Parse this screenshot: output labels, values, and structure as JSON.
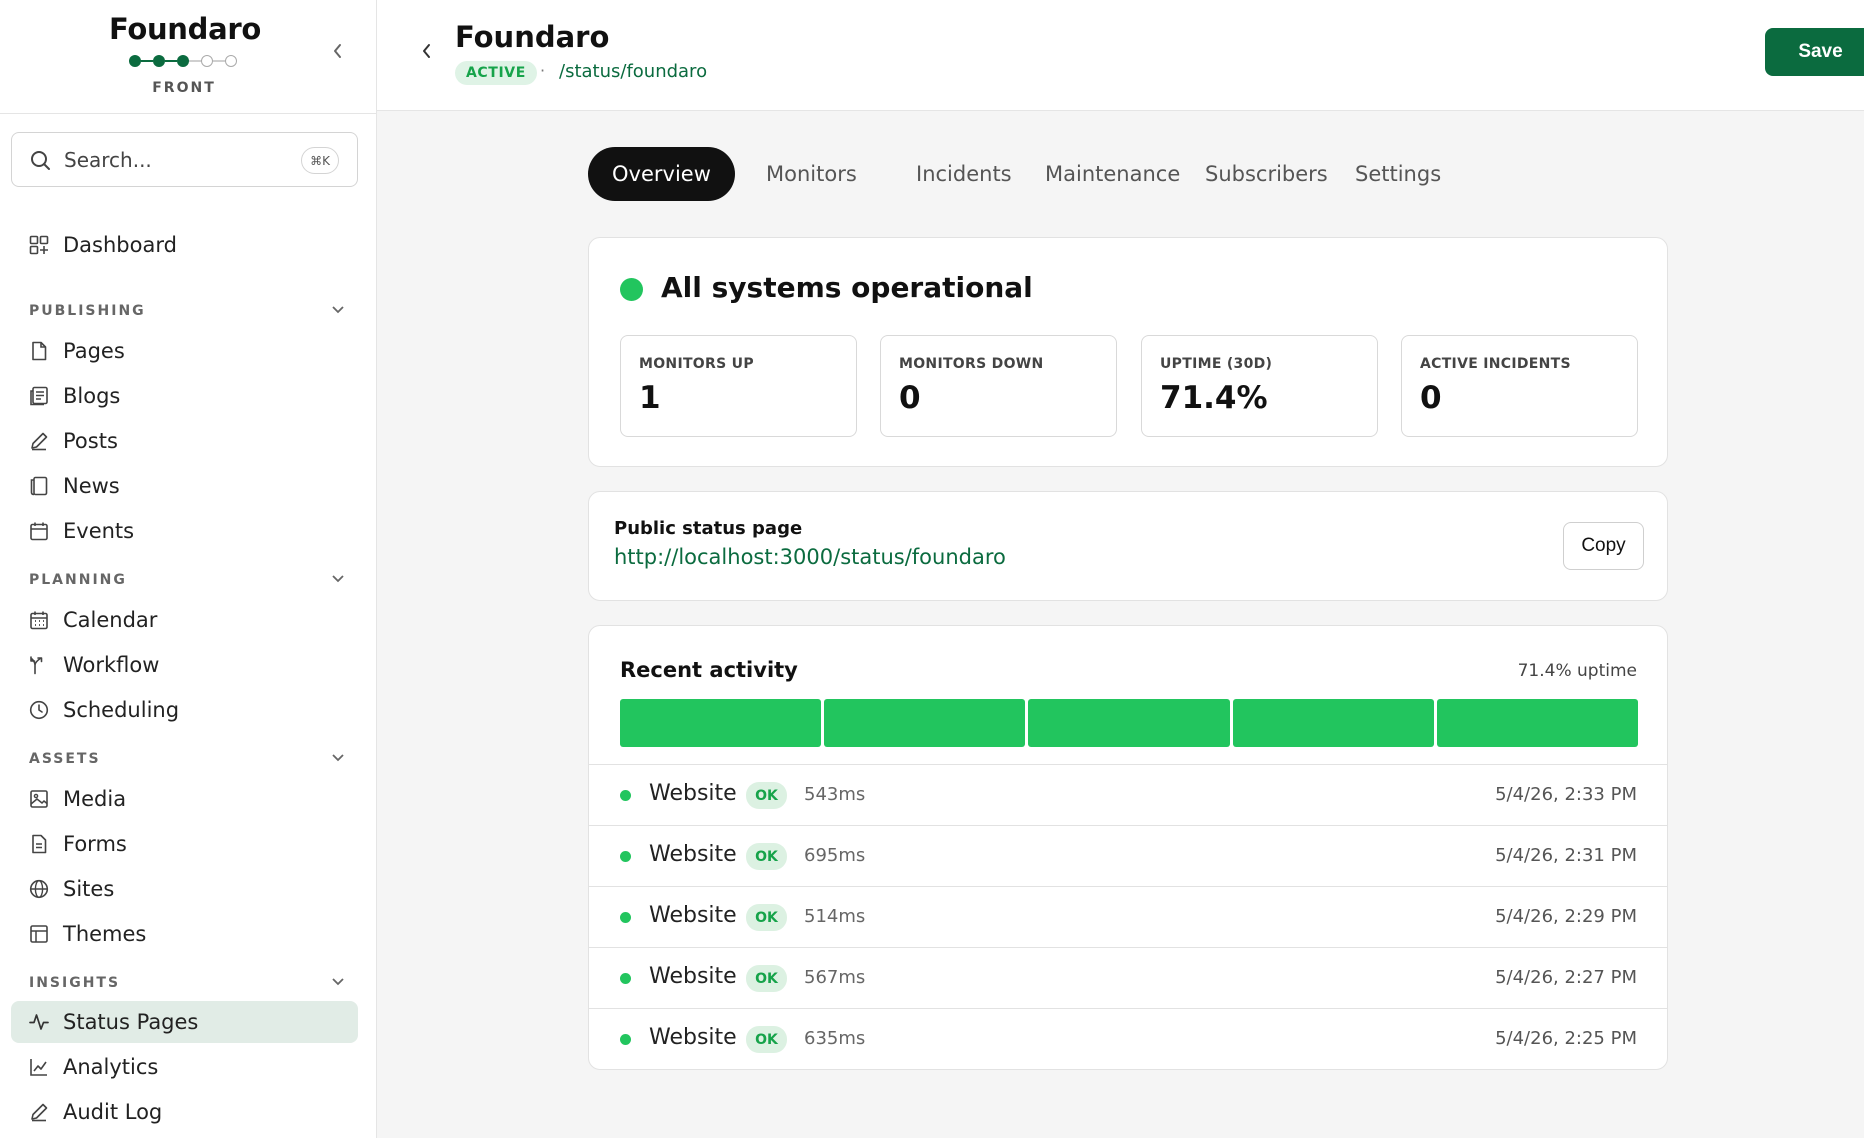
{
  "brand": {
    "name": "Foundaro",
    "sub": "FRONT",
    "steps_done": 3,
    "steps_total": 5
  },
  "search": {
    "placeholder": "Search...",
    "shortcut": "⌘K"
  },
  "sidebar": {
    "dashboard": {
      "label": "Dashboard",
      "icon": "dashboard-icon"
    },
    "sections": [
      {
        "title": "PUBLISHING",
        "items": [
          {
            "label": "Pages",
            "icon": "page-icon"
          },
          {
            "label": "Blogs",
            "icon": "blog-icon"
          },
          {
            "label": "Posts",
            "icon": "pen-icon"
          },
          {
            "label": "News",
            "icon": "news-icon"
          },
          {
            "label": "Events",
            "icon": "calendar-icon"
          }
        ]
      },
      {
        "title": "PLANNING",
        "items": [
          {
            "label": "Calendar",
            "icon": "calendar-grid-icon"
          },
          {
            "label": "Workflow",
            "icon": "workflow-icon"
          },
          {
            "label": "Scheduling",
            "icon": "clock-icon"
          }
        ]
      },
      {
        "title": "ASSETS",
        "items": [
          {
            "label": "Media",
            "icon": "image-icon"
          },
          {
            "label": "Forms",
            "icon": "form-icon"
          },
          {
            "label": "Sites",
            "icon": "globe-icon"
          },
          {
            "label": "Themes",
            "icon": "layout-icon"
          }
        ]
      },
      {
        "title": "INSIGHTS",
        "items": [
          {
            "label": "Status Pages",
            "icon": "activity-icon",
            "active": true
          },
          {
            "label": "Analytics",
            "icon": "chart-icon"
          },
          {
            "label": "Audit Log",
            "icon": "pen-icon"
          }
        ]
      }
    ]
  },
  "header": {
    "title": "Foundaro",
    "status": "ACTIVE",
    "separator": "·",
    "path": "/status/foundaro",
    "save_label": "Save"
  },
  "tabs": [
    "Overview",
    "Monitors",
    "Incidents",
    "Maintenance",
    "Subscribers",
    "Settings"
  ],
  "active_tab": "Overview",
  "overview": {
    "headline": "All systems operational",
    "stats": [
      {
        "label": "MONITORS UP",
        "value": "1"
      },
      {
        "label": "MONITORS DOWN",
        "value": "0"
      },
      {
        "label": "UPTIME (30D)",
        "value": "71.4%"
      },
      {
        "label": "ACTIVE INCIDENTS",
        "value": "0"
      }
    ]
  },
  "public_page": {
    "label": "Public status page",
    "url": "http://localhost:3000/status/foundaro",
    "copy_label": "Copy"
  },
  "activity": {
    "title": "Recent activity",
    "uptime": "71.4% uptime",
    "bar_count": 5,
    "rows": [
      {
        "name": "Website",
        "status": "OK",
        "latency": "543ms",
        "time": "5/4/26, 2:33 PM"
      },
      {
        "name": "Website",
        "status": "OK",
        "latency": "695ms",
        "time": "5/4/26, 2:31 PM"
      },
      {
        "name": "Website",
        "status": "OK",
        "latency": "514ms",
        "time": "5/4/26, 2:29 PM"
      },
      {
        "name": "Website",
        "status": "OK",
        "latency": "567ms",
        "time": "5/4/26, 2:27 PM"
      },
      {
        "name": "Website",
        "status": "OK",
        "latency": "635ms",
        "time": "5/4/26, 2:25 PM"
      }
    ]
  },
  "colors": {
    "accent": "#0b6b3f",
    "ok_green": "#22c55e",
    "active_nav_bg": "#e1ece6"
  }
}
